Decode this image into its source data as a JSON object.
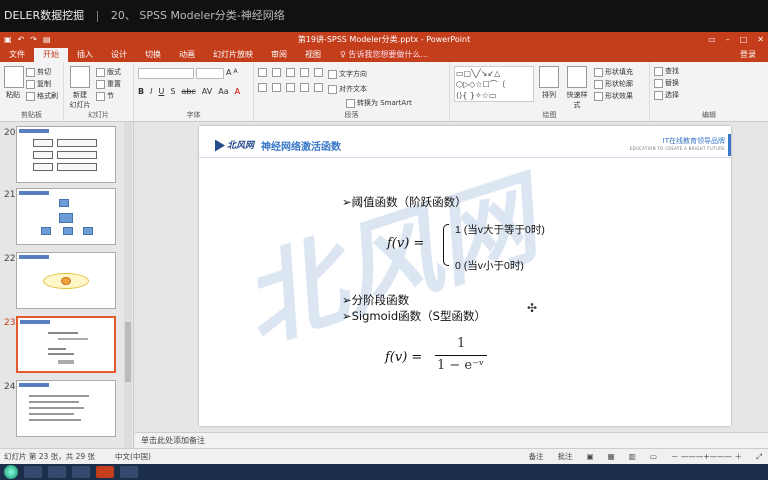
{
  "video_title": {
    "prefix": "DELER数据挖掘",
    "separator": "|",
    "course": "20、 SPSS Modeler分类-神经网络"
  },
  "window": {
    "title": "第19讲-SPSS Modeler分类.pptx - PowerPoint",
    "quick_access": [
      "save",
      "undo",
      "redo",
      "start"
    ],
    "win_buttons": [
      "restore",
      "minimize",
      "maximize",
      "close"
    ]
  },
  "ribbon_tabs": [
    "文件",
    "开始",
    "插入",
    "设计",
    "切换",
    "动画",
    "幻灯片放映",
    "审阅",
    "视图"
  ],
  "active_tab": "开始",
  "tell_me": "♀ 告诉我您想要做什么...",
  "login": "登录",
  "ribbon": {
    "clipboard": {
      "label": "剪贴板",
      "paste": "粘贴",
      "cut": "剪切",
      "copy": "复制",
      "format_painter": "格式刷"
    },
    "slides": {
      "label": "幻灯片",
      "new_slide": "新建",
      "new_slide2": "幻灯片",
      "layout": "版式",
      "reset": "重置",
      "section": "节"
    },
    "font": {
      "label": "字体",
      "bold": "B",
      "italic": "I",
      "underline": "U",
      "strike": "S",
      "abc": "abc",
      "av": "AV",
      "aa": "Aa",
      "a": "A"
    },
    "paragraph": {
      "label": "段落",
      "text_direction": "文字方向",
      "align_text": "对齐文本",
      "smartart": "转换为 SmartArt"
    },
    "drawing": {
      "label": "绘图",
      "arrange": "排列",
      "quick_styles": "快速样式",
      "shape_fill": "形状填充",
      "shape_outline": "形状轮廓",
      "shape_effects": "形状效果"
    },
    "editing": {
      "label": "编辑",
      "find": "查找",
      "replace": "替换",
      "select": "选择"
    }
  },
  "thumbnails": [
    {
      "num": "20",
      "active": false
    },
    {
      "num": "21",
      "active": false
    },
    {
      "num": "22",
      "active": false
    },
    {
      "num": "23",
      "active": true
    },
    {
      "num": "24",
      "active": false
    }
  ],
  "slide": {
    "logo": "北风网",
    "title": "神经网络激活函数",
    "brand_line1": "IT在线教育领导品牌",
    "brand_line2": "EDUCATION TO CREATE A BRIGHT FUTURE",
    "watermark": "北风网",
    "bullet1": "➢阈值函数（阶跃函数）",
    "formula1_lhs": "f(v) =",
    "case1": "1 (当v大于等于0时)",
    "case2": "0 (当v小于0时)",
    "bullet2": "➢分阶段函数",
    "bullet3": "➢Sigmoid函数（S型函数）",
    "formula2_lhs": "f(v) =",
    "formula2_num": "1",
    "formula2_den": "1 − e⁻ᵛ"
  },
  "notes": "单击此处添加备注",
  "status": {
    "slide_info": "幻灯片 第 23 张，共 29 张",
    "language": "中文(中国)",
    "notes_btn": "备注",
    "comments_btn": "批注"
  },
  "taskbar": {
    "clock": ""
  }
}
